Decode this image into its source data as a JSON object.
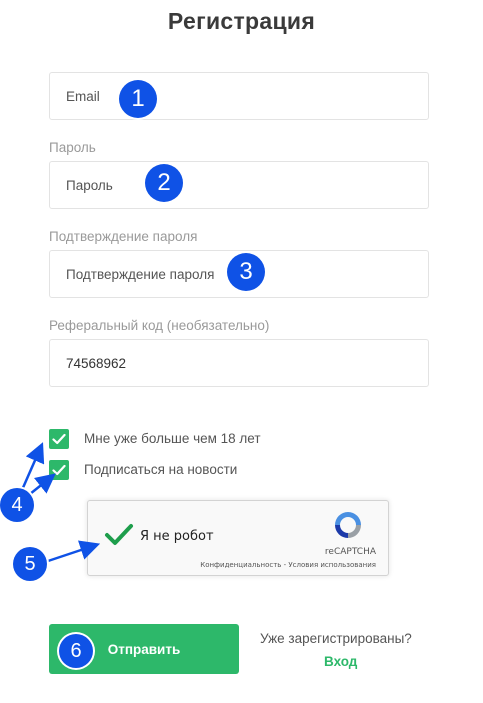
{
  "page_title": "Регистрация",
  "form": {
    "email": {
      "placeholder": "Email",
      "value": ""
    },
    "password": {
      "label": "Пароль",
      "placeholder": "Пароль",
      "value": ""
    },
    "password_confirm": {
      "label": "Подтверждение пароля",
      "placeholder": "Подтверждение пароля",
      "value": ""
    },
    "referral": {
      "label": "Реферальный код (необязательно)",
      "value": "74568962"
    }
  },
  "checkboxes": [
    {
      "label": "Мне уже больше чем 18 лет",
      "checked": true
    },
    {
      "label": "Подписаться на новости",
      "checked": true
    }
  ],
  "recaptcha": {
    "label": "Я не робот",
    "brand": "reCAPTCHA",
    "links": "Конфиденциальность - Условия использования",
    "checked": true
  },
  "submit_label": "Отправить",
  "already_registered": "Уже зарегистрированы?",
  "login_link": "Вход",
  "annotations": [
    "1",
    "2",
    "3",
    "4",
    "5",
    "6"
  ],
  "colors": {
    "accent": "#2db86a",
    "badge": "#0f52e6",
    "border": "#e3e3e3",
    "label": "#9a9a9a"
  }
}
